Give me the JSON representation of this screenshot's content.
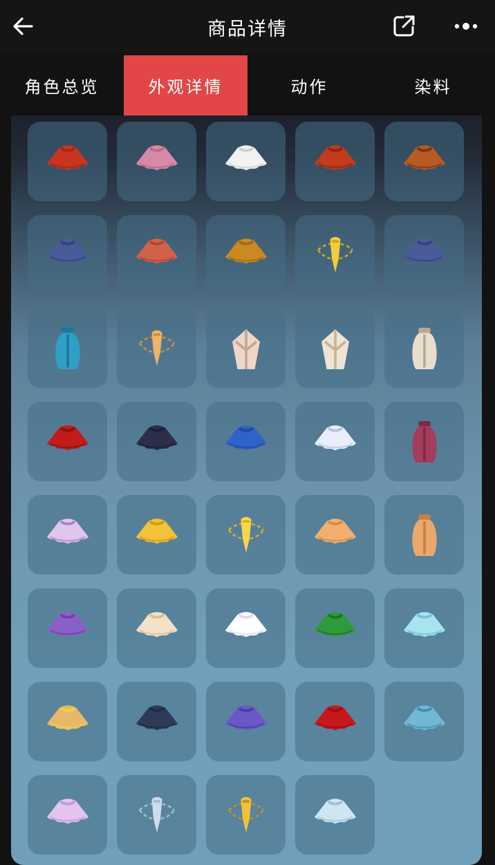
{
  "header": {
    "title": "商品详情",
    "back_icon": "arrow-left-icon",
    "share_icon": "share-icon",
    "more_icon": "more-dots-icon"
  },
  "tabs": [
    {
      "label": "角色总览",
      "active": false
    },
    {
      "label": "外观详情",
      "active": true
    },
    {
      "label": "动作",
      "active": false
    },
    {
      "label": "染料",
      "active": false
    }
  ],
  "colors": {
    "accent": "#e24646",
    "header_bg": "#151515"
  },
  "items": [
    {
      "icon": "cape-icon",
      "colors": [
        "#c8351f",
        "#a42613"
      ]
    },
    {
      "icon": "cape-icon",
      "colors": [
        "#d889a8",
        "#b86a8a"
      ]
    },
    {
      "icon": "cape-icon",
      "colors": [
        "#f2f2f2",
        "#cfcfcf"
      ]
    },
    {
      "icon": "cape-icon",
      "colors": [
        "#c43a1d",
        "#8e2612"
      ]
    },
    {
      "icon": "cape-icon",
      "colors": [
        "#b85a22",
        "#7b3513"
      ]
    },
    {
      "icon": "cape-icon",
      "colors": [
        "#4a5b9a",
        "#34427a"
      ]
    },
    {
      "icon": "cape-icon",
      "colors": [
        "#d0624a",
        "#b04630"
      ]
    },
    {
      "icon": "cape-icon",
      "colors": [
        "#c98a22",
        "#a06912"
      ]
    },
    {
      "icon": "scarf-icon",
      "colors": [
        "#f2cc3a",
        "#d0a820"
      ]
    },
    {
      "icon": "cape-icon",
      "colors": [
        "#4a5b9a",
        "#34427a"
      ]
    },
    {
      "icon": "long-cape-icon",
      "colors": [
        "#2f9fc6",
        "#1b789c"
      ]
    },
    {
      "icon": "scarf-icon",
      "colors": [
        "#f0b464",
        "#d48f3c"
      ]
    },
    {
      "icon": "robe-cape-icon",
      "colors": [
        "#ecd8c8",
        "#c7a894"
      ]
    },
    {
      "icon": "robe-cape-icon",
      "colors": [
        "#efe4d4",
        "#c9b596"
      ]
    },
    {
      "icon": "long-cape-icon",
      "colors": [
        "#e9ddd0",
        "#b9a994"
      ]
    },
    {
      "icon": "cape-icon",
      "colors": [
        "#c11b1b",
        "#8f1010"
      ]
    },
    {
      "icon": "cape-icon",
      "colors": [
        "#2c2f4a",
        "#1c1e33"
      ]
    },
    {
      "icon": "cape-icon",
      "colors": [
        "#2f63c8",
        "#1f4aa0"
      ]
    },
    {
      "icon": "cape-icon",
      "colors": [
        "#e8eefa",
        "#b8c2dc"
      ]
    },
    {
      "icon": "long-cape-icon",
      "colors": [
        "#a43c5c",
        "#7f2a44"
      ]
    },
    {
      "icon": "cape-icon",
      "colors": [
        "#e0c6ee",
        "#a882c8"
      ]
    },
    {
      "icon": "cape-icon",
      "colors": [
        "#f2c238",
        "#d09a18"
      ]
    },
    {
      "icon": "scarf-icon",
      "colors": [
        "#f7d64a",
        "#d8b028"
      ]
    },
    {
      "icon": "cape-icon",
      "colors": [
        "#f2b070",
        "#d08a4a"
      ]
    },
    {
      "icon": "long-cape-icon",
      "colors": [
        "#eaa86a",
        "#c8804a"
      ]
    },
    {
      "icon": "cape-icon",
      "colors": [
        "#8a60c8",
        "#6a44a4"
      ]
    },
    {
      "icon": "cape-icon",
      "colors": [
        "#f3e2c6",
        "#d6bf9c"
      ]
    },
    {
      "icon": "cape-icon",
      "colors": [
        "#ffffff",
        "#e4d4f0"
      ]
    },
    {
      "icon": "cape-icon",
      "colors": [
        "#2f9a3c",
        "#207028"
      ]
    },
    {
      "icon": "cape-icon",
      "colors": [
        "#a8e4f0",
        "#70c2d8"
      ]
    },
    {
      "icon": "cape-icon",
      "colors": [
        "#e8b86a",
        "#f2d040"
      ]
    },
    {
      "icon": "cape-icon",
      "colors": [
        "#2e3b58",
        "#1f2a40"
      ]
    },
    {
      "icon": "cape-icon",
      "colors": [
        "#6a58c8",
        "#4a3ca4"
      ]
    },
    {
      "icon": "cape-icon",
      "colors": [
        "#c8181c",
        "#981014"
      ]
    },
    {
      "icon": "cape-icon",
      "colors": [
        "#72b8d4",
        "#3f8fb0"
      ]
    },
    {
      "icon": "cape-icon",
      "colors": [
        "#e2c4ee",
        "#c29ada"
      ]
    },
    {
      "icon": "scarf-icon",
      "colors": [
        "#cfdceb",
        "#a8bccf"
      ]
    },
    {
      "icon": "scarf-icon",
      "colors": [
        "#f2c238",
        "#c89020"
      ]
    },
    {
      "icon": "cape-icon",
      "colors": [
        "#cfe6f2",
        "#9cc2d6"
      ]
    }
  ]
}
